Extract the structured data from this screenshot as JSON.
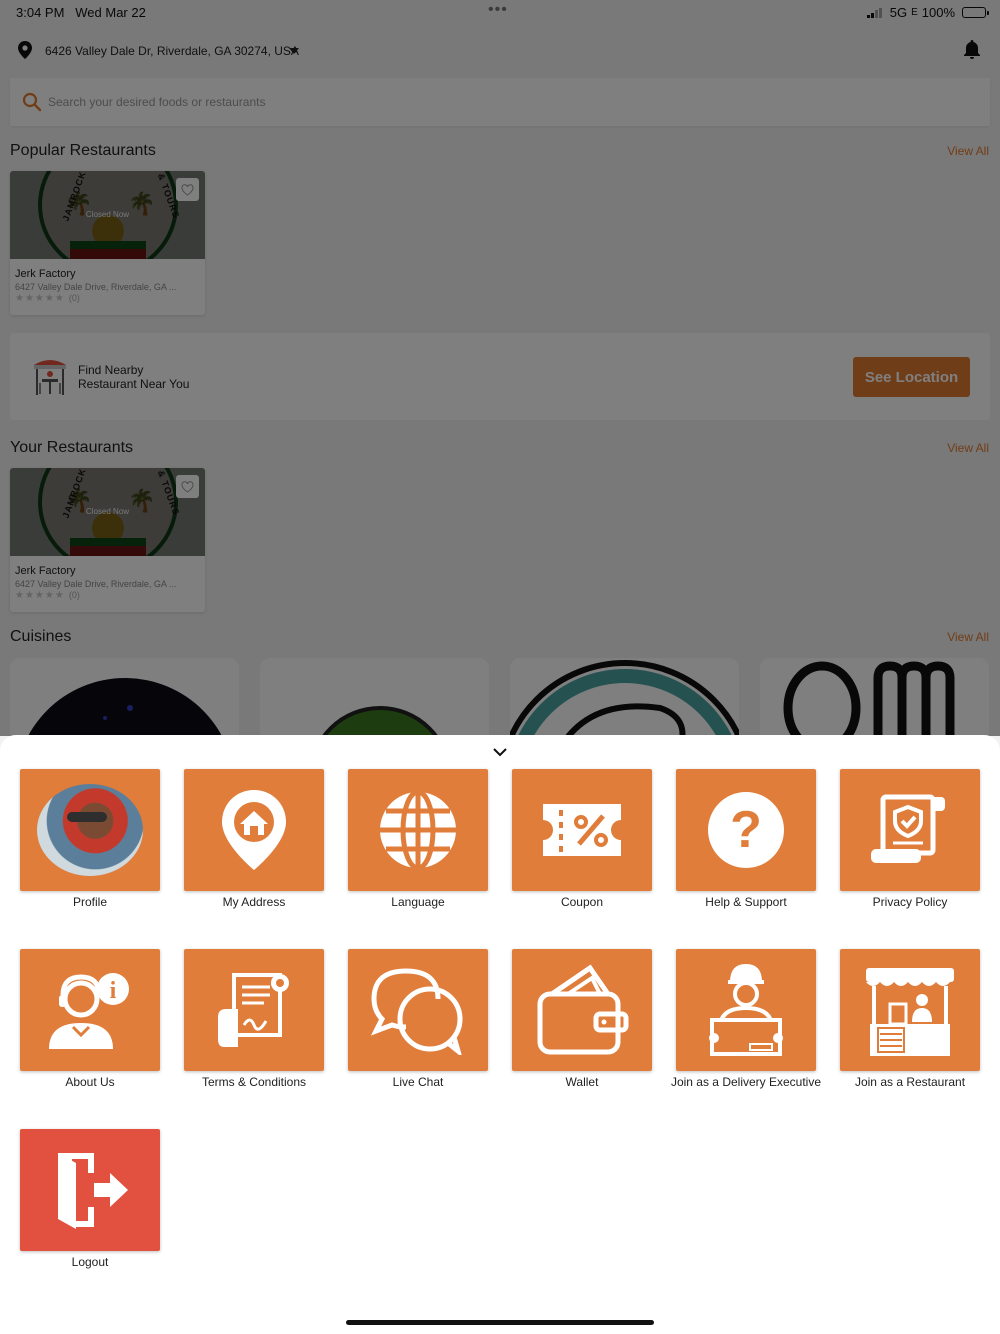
{
  "status_bar": {
    "time": "3:04 PM",
    "date": "Wed Mar 22",
    "network": "5G",
    "network_sub": "E",
    "battery": "100%"
  },
  "header": {
    "address": "6426 Valley Dale Dr, Riverdale, GA 30274, USA"
  },
  "search": {
    "placeholder": "Search your desired foods or restaurants"
  },
  "popular": {
    "title": "Popular Restaurants",
    "view_all": "View All",
    "card": {
      "name": "Jerk Factory",
      "address": "6427 Valley Dale Drive, Riverdale, GA ...",
      "rating_count": "(0)",
      "status": "Closed Now",
      "logo_text_left": "JAMROCK",
      "logo_text_right": "& TOURS"
    }
  },
  "nearby": {
    "line1": "Find Nearby",
    "line2": "Restaurant Near You",
    "button": "See Location"
  },
  "yours": {
    "title": "Your Restaurants",
    "view_all": "View All",
    "card": {
      "name": "Jerk Factory",
      "address": "6427 Valley Dale Drive, Riverdale, GA ...",
      "rating_count": "(0)",
      "status": "Closed Now",
      "logo_text_left": "JAMROCK",
      "logo_text_right": "& TOURS"
    }
  },
  "cuisines": {
    "title": "Cuisines",
    "view_all": "View All"
  },
  "menu": {
    "items": [
      {
        "label": "Profile",
        "icon": "avatar"
      },
      {
        "label": "My Address",
        "icon": "home-pin-icon"
      },
      {
        "label": "Language",
        "icon": "globe-icon"
      },
      {
        "label": "Coupon",
        "icon": "coupon-icon"
      },
      {
        "label": "Help & Support",
        "icon": "question-icon"
      },
      {
        "label": "Privacy Policy",
        "icon": "privacy-scroll-icon"
      },
      {
        "label": "About Us",
        "icon": "about-person-icon"
      },
      {
        "label": "Terms & Conditions",
        "icon": "terms-document-icon"
      },
      {
        "label": "Live Chat",
        "icon": "chat-bubbles-icon"
      },
      {
        "label": "Wallet",
        "icon": "wallet-icon"
      },
      {
        "label": "Join as a Delivery Executive",
        "icon": "delivery-man-icon"
      },
      {
        "label": "Join as a Restaurant",
        "icon": "restaurant-stall-icon"
      },
      {
        "label": "Logout",
        "icon": "logout-door-icon"
      }
    ]
  },
  "colors": {
    "accent": "#e07d3a",
    "logout": "#e2503f",
    "link": "#e27b2c"
  }
}
